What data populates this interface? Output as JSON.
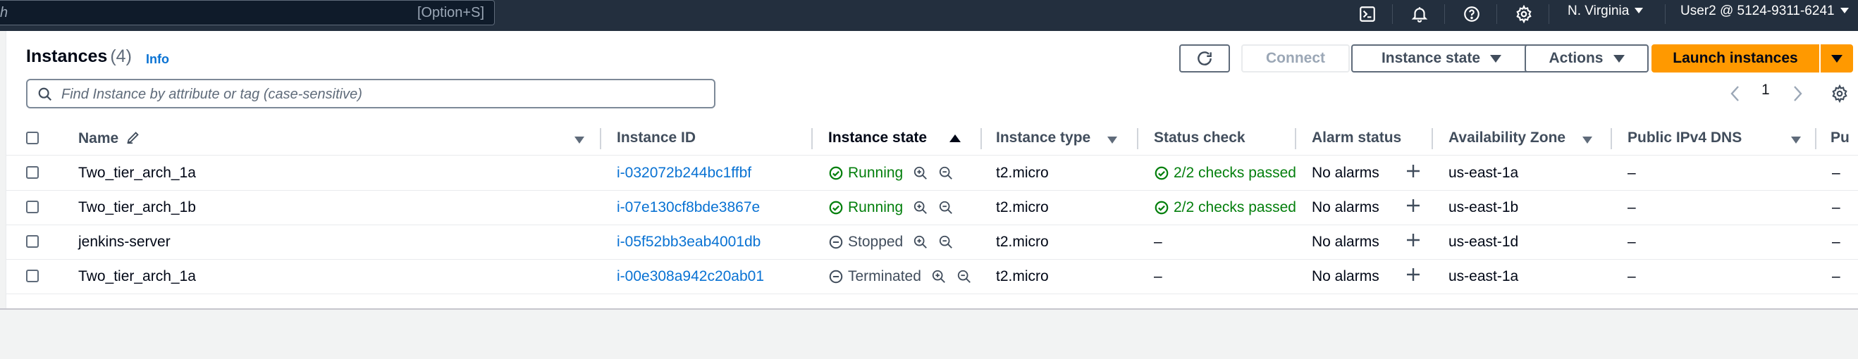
{
  "topbar": {
    "search_partial": "h",
    "search_shortcut": "[Option+S]",
    "icons": [
      "cloudshell-icon",
      "notifications-icon",
      "help-icon",
      "settings-icon"
    ],
    "region": "N. Virginia",
    "account": "User2 @ 5124-9311-6241"
  },
  "header": {
    "title": "Instances",
    "count": "(4)",
    "info": "Info",
    "refresh_icon": "refresh-icon",
    "connect_label": "Connect",
    "instance_state_label": "Instance state",
    "actions_label": "Actions",
    "launch_label": "Launch instances"
  },
  "filter": {
    "placeholder": "Find Instance by attribute or tag (case-sensitive)"
  },
  "pagination": {
    "page": "1"
  },
  "table": {
    "columns": {
      "name": "Name",
      "instance_id": "Instance ID",
      "instance_state": "Instance state",
      "instance_type": "Instance type",
      "status_check": "Status check",
      "alarm_status": "Alarm status",
      "availability_zone": "Availability Zone",
      "public_dns": "Public IPv4 DNS",
      "public_ip_partial": "Pu"
    },
    "rows": [
      {
        "name": "Two_tier_arch_1a",
        "id": "i-032072b244bc1ffbf",
        "state": "Running",
        "type": "t2.micro",
        "status": "2/2 checks passed",
        "alarm": "No alarms",
        "az": "us-east-1a",
        "dns": "–",
        "ip": "–"
      },
      {
        "name": "Two_tier_arch_1b",
        "id": "i-07e130cf8bde3867e",
        "state": "Running",
        "type": "t2.micro",
        "status": "2/2 checks passed",
        "alarm": "No alarms",
        "az": "us-east-1b",
        "dns": "–",
        "ip": "–"
      },
      {
        "name": "jenkins-server",
        "id": "i-05f52bb3eab4001db",
        "state": "Stopped",
        "type": "t2.micro",
        "status": "–",
        "alarm": "No alarms",
        "az": "us-east-1d",
        "dns": "–",
        "ip": "–"
      },
      {
        "name": "Two_tier_arch_1a",
        "id": "i-00e308a942c20ab01",
        "state": "Terminated",
        "type": "t2.micro",
        "status": "–",
        "alarm": "No alarms",
        "az": "us-east-1a",
        "dns": "–",
        "ip": "–"
      }
    ]
  },
  "colors": {
    "topbar": "#232f3e",
    "accent_orange": "#ff9900",
    "link_blue": "#0972d3",
    "success_green": "#037f0c"
  }
}
